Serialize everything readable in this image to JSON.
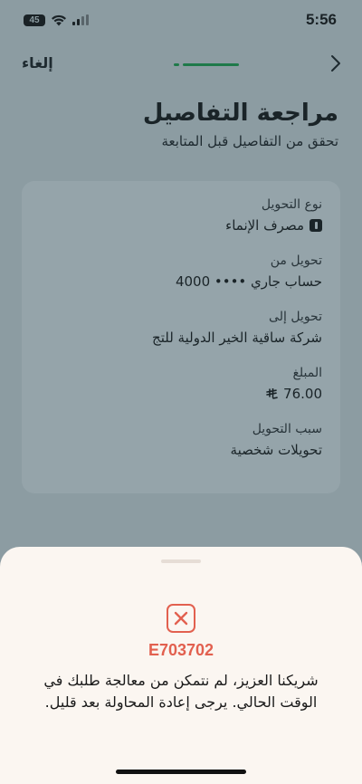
{
  "status_bar": {
    "time": "5:56",
    "battery": "45"
  },
  "nav": {
    "cancel_label": "إلغاء",
    "back_icon": "chevron-right-icon"
  },
  "header": {
    "title": "مراجعة التفاصيل",
    "subtitle": "تحقق من التفاصيل قبل المتابعة"
  },
  "details": [
    {
      "label": "نوع التحويل",
      "value": "مصرف الإنماء"
    },
    {
      "label": "تحويل من",
      "value": "حساب جاري •••• 4000"
    },
    {
      "label": "تحويل إلى",
      "value": "شركة ساقية الخير الدولية للتج"
    },
    {
      "label": "المبلغ",
      "value": "76.00"
    },
    {
      "label": "سبب التحويل",
      "value": "تحويلات شخصية"
    }
  ],
  "sheet": {
    "error_code": "E703702",
    "error_message": "شريكنا العزيز، لم نتمكن من معالجة طلبك في الوقت الحالي. يرجى إعادة المحاولة بعد قليل."
  },
  "colors": {
    "accent_green": "#1f7a4a",
    "error_red": "#e2604f",
    "sheet_bg": "#fbf6f1"
  }
}
